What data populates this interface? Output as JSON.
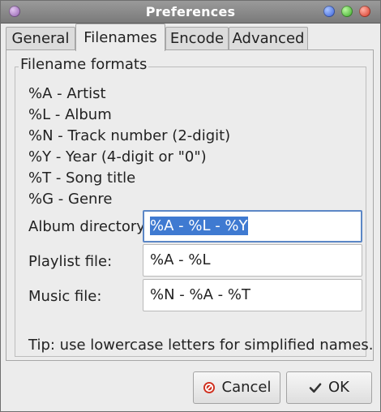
{
  "window": {
    "title": "Preferences"
  },
  "tabs": [
    {
      "label": "General",
      "active": false
    },
    {
      "label": "Filenames",
      "active": true
    },
    {
      "label": "Encode",
      "active": false
    },
    {
      "label": "Advanced",
      "active": false
    }
  ],
  "filename_formats": {
    "legend": "Filename formats",
    "codes": [
      "%A - Artist",
      "%L - Album",
      "%N - Track number (2-digit)",
      "%Y - Year (4-digit or \"0\")",
      "%T - Song title",
      "%G - Genre"
    ],
    "album_directory": {
      "label": "Album directory:",
      "value": "%A - %L - %Y"
    },
    "playlist_file": {
      "label": "Playlist file:",
      "value": "%A - %L"
    },
    "music_file": {
      "label": "Music file:",
      "value": "%N - %A - %T"
    },
    "tip": "Tip: use lowercase letters for simplified names."
  },
  "buttons": {
    "cancel": "Cancel",
    "ok": "OK"
  },
  "colors": {
    "selection": "#3f7ad1",
    "cancel_icon": "#d0301f",
    "titlebar": "#8a8a8a"
  },
  "icons": {
    "cancel": "no-entry-icon",
    "ok": "checkmark-icon"
  }
}
